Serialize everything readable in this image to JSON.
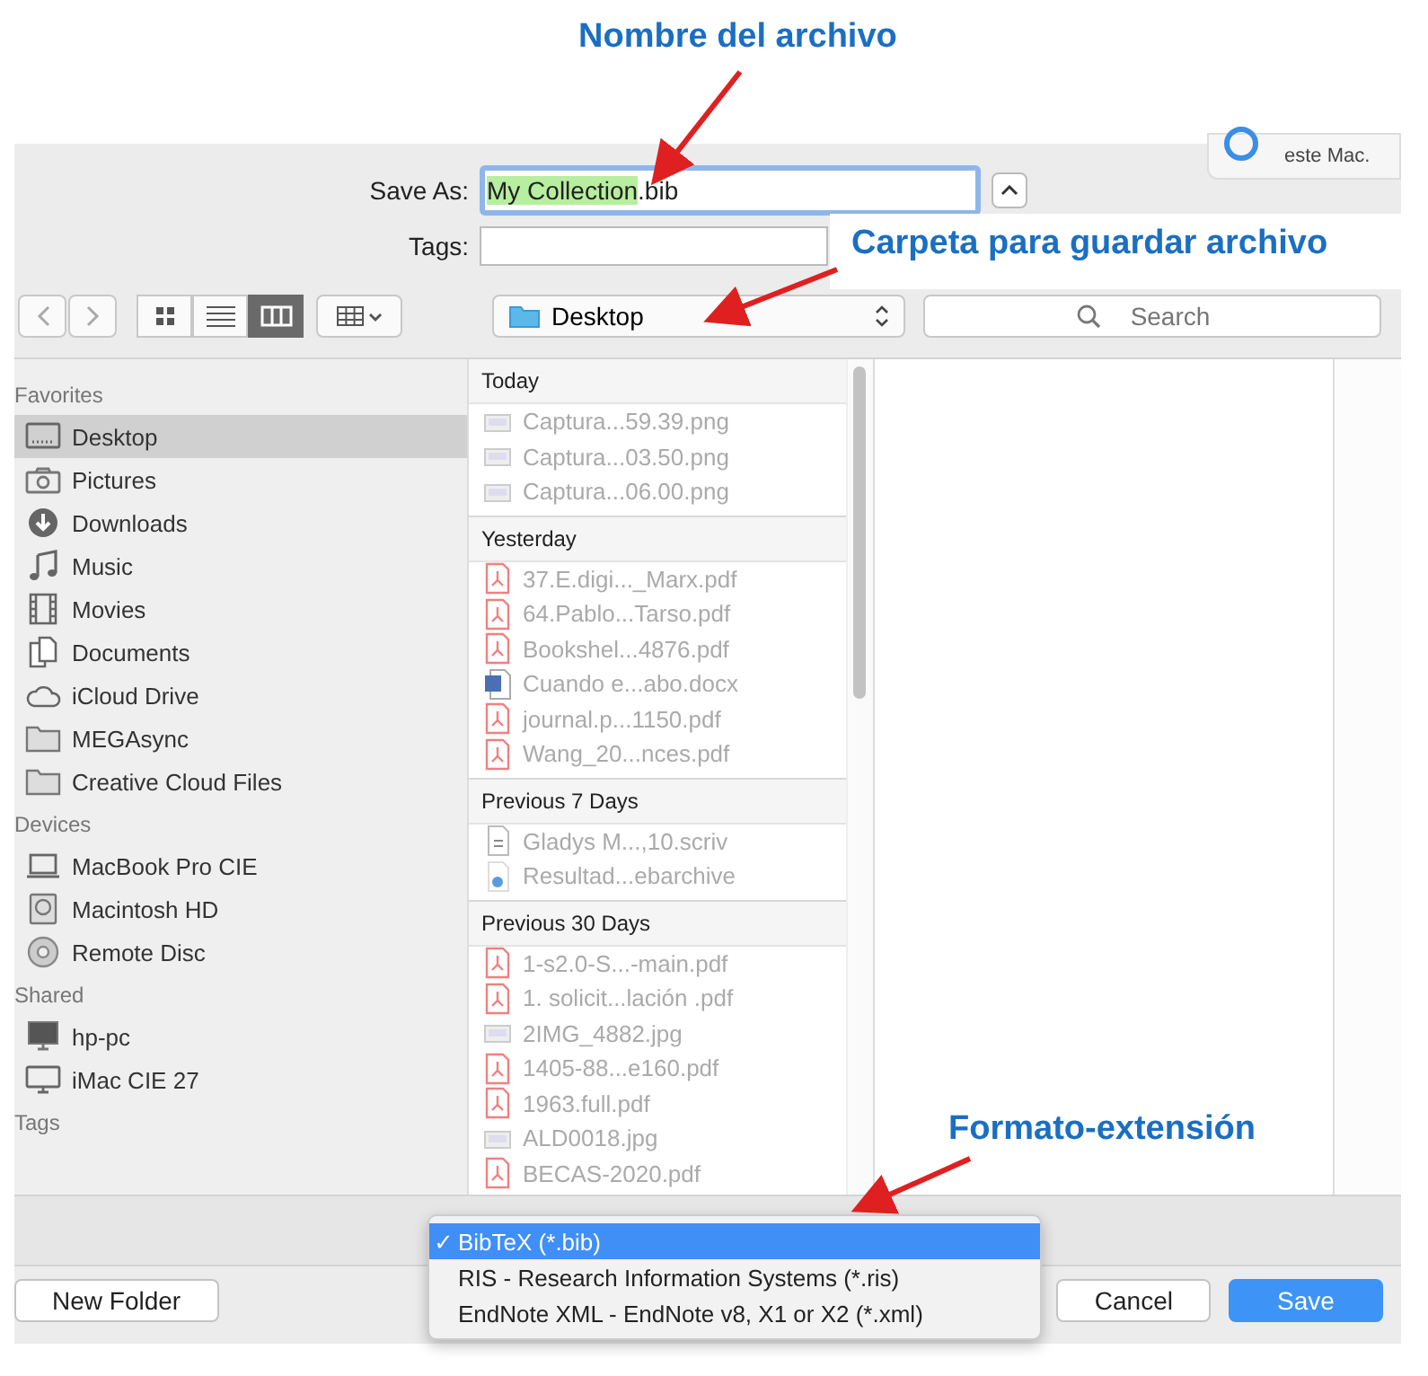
{
  "annotations": [
    {
      "text": "Nombre del archivo"
    },
    {
      "text": "Carpeta para guardar archivo"
    },
    {
      "text": "Formato-extensión"
    }
  ],
  "notification": {
    "text": "este Mac."
  },
  "save_as": {
    "label": "Save As:",
    "value_highlighted": "My Collection",
    "value_rest": ".bib"
  },
  "tags": {
    "label": "Tags:"
  },
  "toolbar": {
    "view_modes": [
      {
        "kind": "icons",
        "selected": false
      },
      {
        "kind": "list",
        "selected": false
      },
      {
        "kind": "columns",
        "selected": true
      }
    ],
    "location": "Desktop",
    "search": {
      "placeholder": "Search"
    }
  },
  "sidebar": [
    {
      "title": "Favorites",
      "items": [
        {
          "label": "Desktop",
          "kind": "desktop",
          "selected": true
        },
        {
          "label": "Pictures",
          "kind": "camera",
          "selected": false
        },
        {
          "label": "Downloads",
          "kind": "download",
          "selected": false
        },
        {
          "label": "Music",
          "kind": "music",
          "selected": false
        },
        {
          "label": "Movies",
          "kind": "film",
          "selected": false
        },
        {
          "label": "Documents",
          "kind": "documents",
          "selected": false
        },
        {
          "label": "iCloud Drive",
          "kind": "cloud",
          "selected": false
        },
        {
          "label": "MEGAsync",
          "kind": "folder",
          "selected": false
        },
        {
          "label": "Creative Cloud Files",
          "kind": "folder",
          "selected": false
        }
      ]
    },
    {
      "title": "Devices",
      "items": [
        {
          "label": "MacBook Pro CIE",
          "kind": "laptop",
          "selected": false
        },
        {
          "label": "Macintosh HD",
          "kind": "disk",
          "selected": false
        },
        {
          "label": "Remote Disc",
          "kind": "disc",
          "selected": false
        }
      ]
    },
    {
      "title": "Shared",
      "items": [
        {
          "label": "hp-pc",
          "kind": "pc",
          "selected": false
        },
        {
          "label": "iMac CIE 27",
          "kind": "monitor",
          "selected": false
        }
      ]
    },
    {
      "title": "Tags"
    }
  ],
  "file_groups": [
    {
      "title": "Today",
      "files": [
        {
          "name": "Captura...59.39.png",
          "kind": "image"
        },
        {
          "name": "Captura...03.50.png",
          "kind": "image"
        },
        {
          "name": "Captura...06.00.png",
          "kind": "image"
        }
      ]
    },
    {
      "title": "Yesterday",
      "files": [
        {
          "name": "37.E.digi..._Marx.pdf",
          "kind": "pdf"
        },
        {
          "name": "64.Pablo...Tarso.pdf",
          "kind": "pdf"
        },
        {
          "name": "Bookshel...4876.pdf",
          "kind": "pdf"
        },
        {
          "name": "Cuando e...abo.docx",
          "kind": "word"
        },
        {
          "name": "journal.p...1150.pdf",
          "kind": "pdf"
        },
        {
          "name": "Wang_20...nces.pdf",
          "kind": "pdf"
        }
      ]
    },
    {
      "title": "Previous 7 Days",
      "files": [
        {
          "name": "Gladys M...,10.scriv",
          "kind": "scriv"
        },
        {
          "name": "Resultad...ebarchive",
          "kind": "archive"
        }
      ]
    },
    {
      "title": "Previous 30 Days",
      "files": [
        {
          "name": "1-s2.0-S...-main.pdf",
          "kind": "pdf"
        },
        {
          "name": "1. solicit...lación .pdf",
          "kind": "pdf"
        },
        {
          "name": "2IMG_4882.jpg",
          "kind": "image"
        },
        {
          "name": "1405-88...e160.pdf",
          "kind": "pdf"
        },
        {
          "name": "1963.full.pdf",
          "kind": "pdf"
        },
        {
          "name": "ALD0018.jpg",
          "kind": "image"
        },
        {
          "name": "BECAS-2020.pdf",
          "kind": "pdf"
        }
      ]
    }
  ],
  "format_menu": [
    {
      "label": "BibTeX (*.bib)",
      "selected": true,
      "check": "✓"
    },
    {
      "label": "RIS - Research Information Systems (*.ris)",
      "selected": false
    },
    {
      "label": "EndNote XML - EndNote v8, X1 or X2 (*.xml)",
      "selected": false
    }
  ],
  "buttons": {
    "new_folder": "New Folder",
    "cancel": "Cancel",
    "save": "Save"
  }
}
